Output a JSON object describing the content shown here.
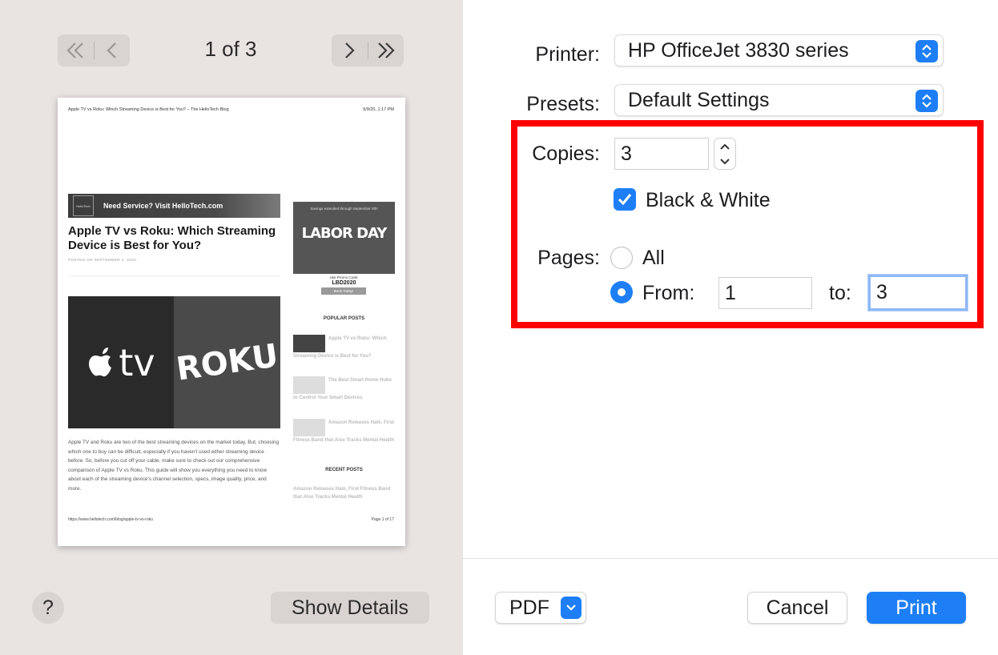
{
  "preview": {
    "page_indicator": "1 of 3",
    "page": {
      "header_left": "Apple TV vs Roku: Which Streaming Device is Best for You? – The HelloTech Blog",
      "header_right": "9/9/20, 1:17 PM",
      "banner_logo": "HelloTech",
      "banner_text": "Need Service? Visit HelloTech.com",
      "title": "Apple TV vs Roku: Which Streaming Device is Best for You?",
      "date": "POSTED ON SEPTEMBER 4, 2020",
      "hero_left": "tv",
      "hero_right": "ROKU",
      "body": "Apple TV and Roku are two of the best streaming devices on the market today. But, choosing which one to buy can be difficult, especially if you haven't used either streaming device before. So, before you cut off your cable, make sure to check out our comprehensive comparison of Apple TV vs Roku. This guide will show you everything you need to know about each of the streaming device's channel selection, specs, image quality, price, and more.",
      "footer_left": "https://www.hellotech.com/blog/apple-tv-vs-roku",
      "footer_right": "Page 1 of 17",
      "ad_top": "Savings extended through September 9th!",
      "ad_big": "LABOR DAY",
      "ad_code_label": "Use Promo Code:",
      "ad_code": "LBD2020",
      "ad_button": "Book Today!",
      "popular_heading": "POPULAR POSTS",
      "popular_posts": [
        "Apple TV vs Roku: Which Streaming Device is Best for You?",
        "The Best Smart Home Hubs to Control Your Smart Devices",
        "Amazon Releases Halo, First Fitness Band that Also Tracks Mental Health"
      ],
      "recent_heading": "RECENT POSTS",
      "recent_post": "Amazon Releases Halo, First Fitness Band that Also Tracks Mental Health"
    },
    "help_label": "?",
    "show_details_label": "Show Details"
  },
  "settings": {
    "printer_label": "Printer:",
    "printer_value": "HP OfficeJet 3830 series",
    "presets_label": "Presets:",
    "presets_value": "Default Settings",
    "copies_label": "Copies:",
    "copies_value": "3",
    "bw_label": "Black & White",
    "bw_checked": true,
    "pages_label": "Pages:",
    "all_label": "All",
    "from_label": "From:",
    "from_value": "1",
    "to_label": "to:",
    "to_value": "3",
    "selected_range": "from"
  },
  "footer": {
    "pdf_label": "PDF",
    "cancel_label": "Cancel",
    "print_label": "Print"
  },
  "colors": {
    "accent": "#1e7ef6",
    "highlight_box": "#ff0000",
    "sidebar_bg": "#e9e4e2"
  }
}
